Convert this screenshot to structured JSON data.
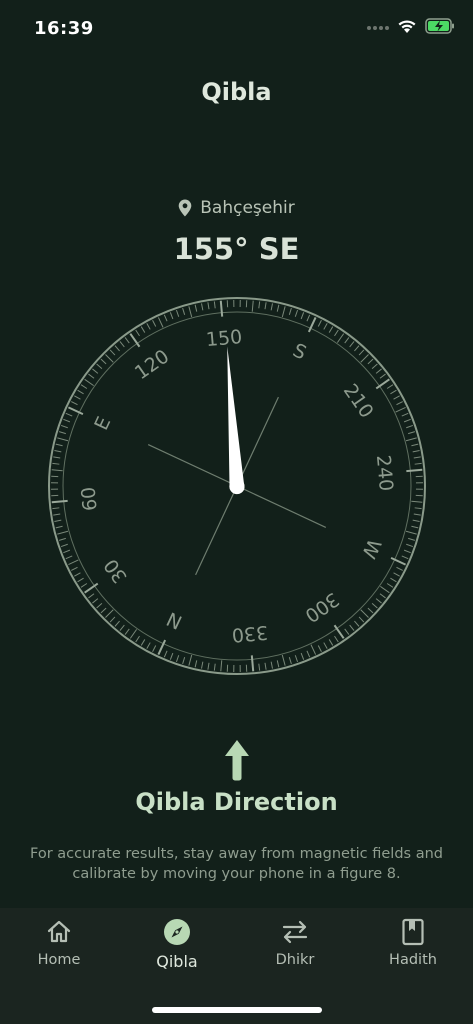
{
  "status": {
    "time": "16:39"
  },
  "header": {
    "title": "Qibla"
  },
  "location": {
    "name": "Bahçeşehir"
  },
  "heading": {
    "readout": "155° SE"
  },
  "compass": {
    "heading_degrees": 155,
    "labels": [
      {
        "text": "N",
        "deg": 0
      },
      {
        "text": "30",
        "deg": 30
      },
      {
        "text": "60",
        "deg": 60
      },
      {
        "text": "E",
        "deg": 90
      },
      {
        "text": "120",
        "deg": 120
      },
      {
        "text": "150",
        "deg": 150
      },
      {
        "text": "S",
        "deg": 180
      },
      {
        "text": "210",
        "deg": 210
      },
      {
        "text": "240",
        "deg": 240
      },
      {
        "text": "W",
        "deg": 270
      },
      {
        "text": "300",
        "deg": 300
      },
      {
        "text": "330",
        "deg": 330
      }
    ]
  },
  "qibla": {
    "title": "Qibla Direction",
    "hint": "For accurate results, stay away from magnetic fields and calibrate by moving your phone in a figure 8."
  },
  "tabs": [
    {
      "label": "Home",
      "icon": "home-icon"
    },
    {
      "label": "Qibla",
      "icon": "compass-icon"
    },
    {
      "label": "Dhikr",
      "icon": "swap-arrows-icon"
    },
    {
      "label": "Hadith",
      "icon": "bookmark-book-icon"
    }
  ],
  "colors": {
    "background": "#12201a",
    "accent": "#b8d8b4",
    "tabbar": "#1b2520"
  }
}
